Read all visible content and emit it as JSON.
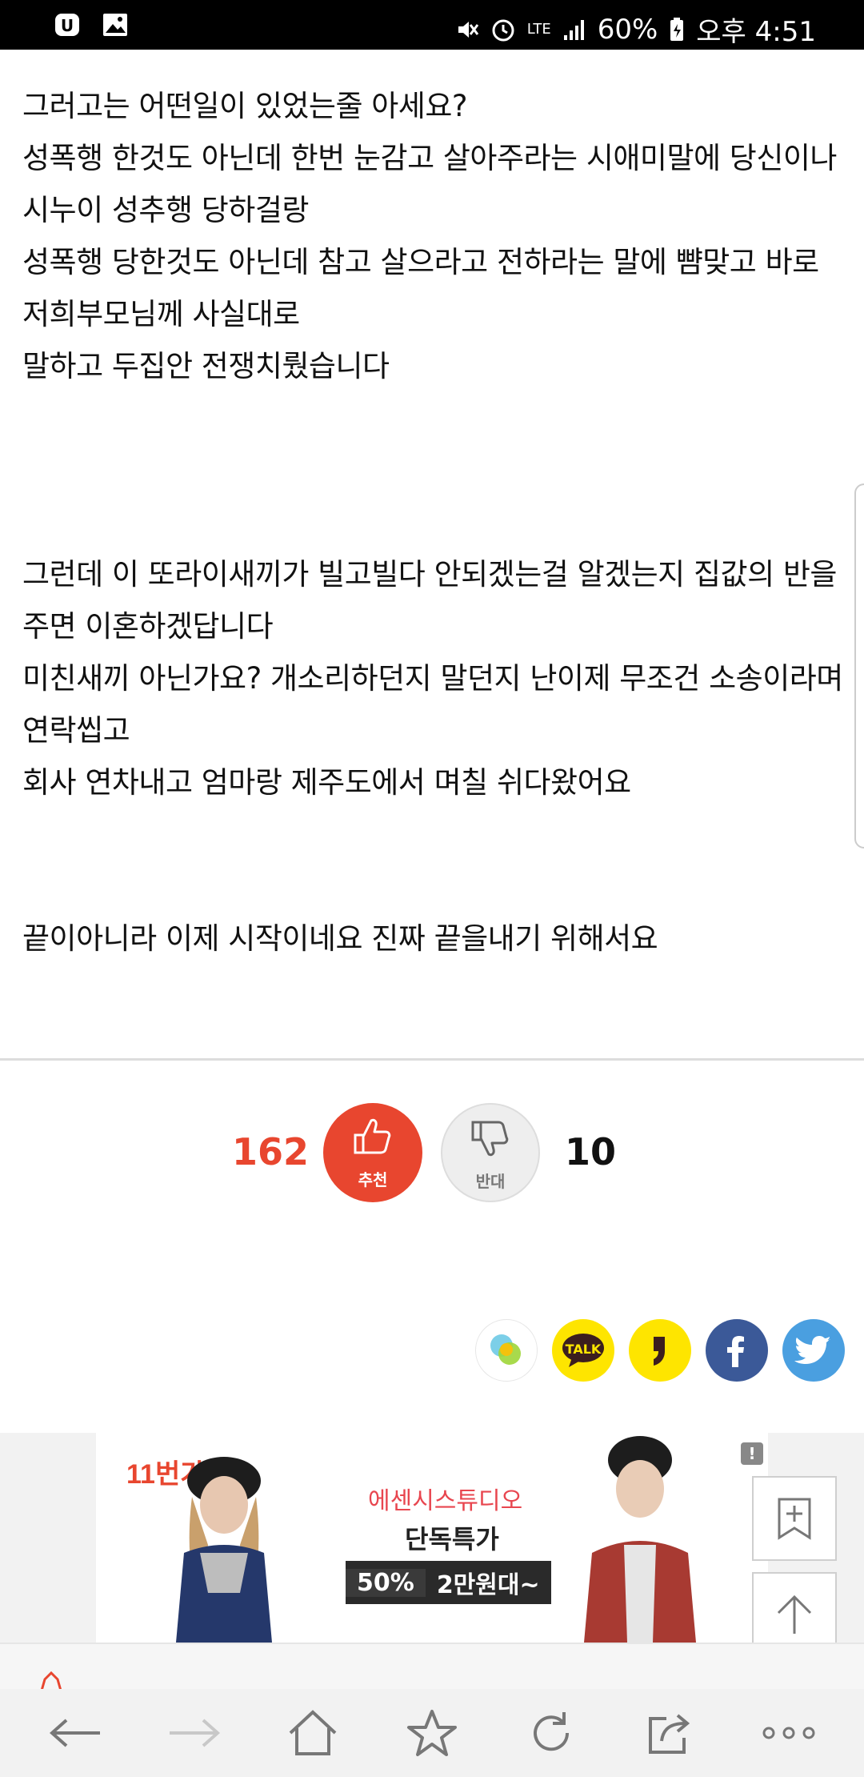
{
  "status_bar": {
    "battery": "60%",
    "time": "오후 4:51",
    "network": "LTE",
    "icons": [
      "notification-icon",
      "gallery-icon",
      "mute-icon",
      "alarm-icon",
      "signal-icon",
      "battery-icon"
    ]
  },
  "article": {
    "paragraph1": [
      "그러고는 어떤일이 있었는줄 아세요?",
      "성폭행 한것도 아닌데 한번 눈감고 살아주라는 시애미말에 당신이나 시누이 성추행 당하걸랑",
      "성폭행 당한것도 아닌데 참고 살으라고 전하라는 말에 뺨맞고 바로 저희부모님께 사실대로",
      "말하고 두집안 전쟁치뤘습니다"
    ],
    "paragraph2": [
      "그런데 이 또라이새끼가 빌고빌다 안되겠는걸 알겠는지 집값의 반을 주면 이혼하겠답니다",
      "미친새끼 아닌가요? 개소리하던지 말던지 난이제 무조건 소송이라며 연락씹고",
      "회사 연차내고 엄마랑 제주도에서 며칠 쉬다왔어요"
    ],
    "paragraph3": [
      "끝이아니라 이제 시작이네요 진짜 끝을내기 위해서요"
    ]
  },
  "vote": {
    "up_count": "162",
    "up_label": "추천",
    "down_label": "반대",
    "down_count": "10"
  },
  "share": {
    "buttons": [
      "kakaostory-icon",
      "kakaotalk-icon",
      "kakao-icon",
      "facebook-icon",
      "twitter-icon"
    ],
    "talk_label": "TALK"
  },
  "ad": {
    "logo": "11번가",
    "title": "에센시스튜디오",
    "subtitle": "단독특가",
    "badge_percent": "50%",
    "badge_price": "2만원대~",
    "info": "!"
  },
  "colors": {
    "accent": "#e8462f",
    "facebook": "#3b5998",
    "twitter": "#4a9fe0",
    "kakao": "#fee500"
  },
  "navbar": {
    "items": [
      "back-icon",
      "forward-icon",
      "home-icon",
      "bookmark-star-icon",
      "refresh-icon",
      "share-icon",
      "more-icon"
    ]
  }
}
